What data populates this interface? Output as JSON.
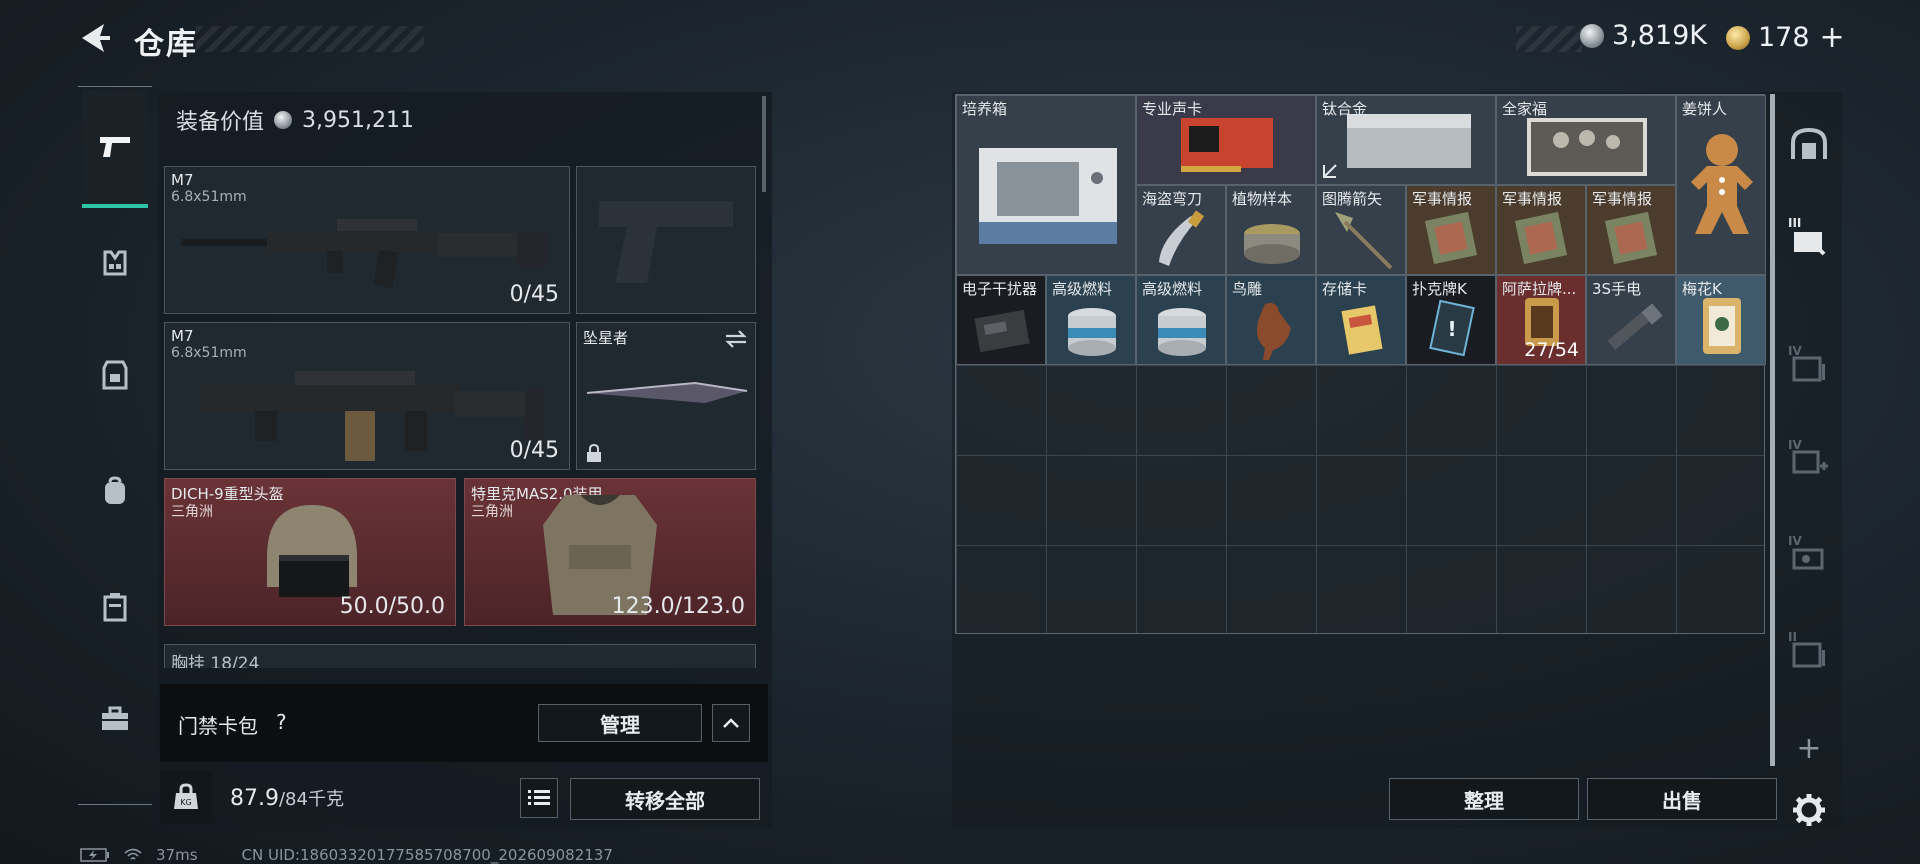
{
  "header": {
    "title": "仓库",
    "silver_amount": "3,819K",
    "gold_amount": "178"
  },
  "equipment": {
    "value_label": "装备价值",
    "value": "3,951,211",
    "primary_weapon": {
      "name": "M7",
      "caliber": "6.8x51mm",
      "ammo": "0/45"
    },
    "secondary_weapon": {
      "name": "M7",
      "caliber": "6.8x51mm",
      "ammo": "0/45"
    },
    "melee": {
      "name": "坠星者"
    },
    "helmet": {
      "name": "DICH-9重型头盔",
      "origin": "三角洲",
      "durability": "50.0/50.0"
    },
    "armor": {
      "name": "特里克MAS2.0装甲",
      "origin": "三角洲",
      "durability": "123.0/123.0"
    },
    "chest_rig_partial": "胸挂 18/24"
  },
  "keycard": {
    "label": "门禁卡包",
    "help": "?",
    "manage_label": "管理"
  },
  "weight": {
    "current": "87.9",
    "max_unit": "/84千克",
    "transfer_all_label": "转移全部"
  },
  "status": {
    "ping": "37ms",
    "uid": "CN UID:18603320177585708700_202609082137"
  },
  "stash_items": [
    {
      "name": "培养箱",
      "icon": "incubator-icon"
    },
    {
      "name": "专业声卡",
      "icon": "sound-card-icon"
    },
    {
      "name": "钛合金",
      "icon": "titanium-plate-icon"
    },
    {
      "name": "全家福",
      "icon": "family-photo-icon"
    },
    {
      "name": "姜饼人",
      "icon": "gingerbread-icon"
    },
    {
      "name": "海盗弯刀",
      "icon": "pirate-knife-icon"
    },
    {
      "name": "植物样本",
      "icon": "plant-sample-icon"
    },
    {
      "name": "图腾箭矢",
      "icon": "totem-arrow-icon"
    },
    {
      "name": "军事情报",
      "icon": "intel-icon"
    },
    {
      "name": "军事情报",
      "icon": "intel-icon"
    },
    {
      "name": "军事情报",
      "icon": "intel-icon"
    },
    {
      "name": "电子干扰器",
      "icon": "jammer-icon"
    },
    {
      "name": "高级燃料",
      "icon": "fuel-can-icon"
    },
    {
      "name": "高级燃料",
      "icon": "fuel-can-icon"
    },
    {
      "name": "鸟雕",
      "icon": "bird-statue-icon"
    },
    {
      "name": "存储卡",
      "icon": "memory-card-icon"
    },
    {
      "name": "扑克牌K",
      "icon": "poker-card-icon"
    },
    {
      "name": "阿萨拉牌...",
      "icon": "asala-card-icon",
      "count": "27/54"
    },
    {
      "name": "3S手电",
      "icon": "flashlight-icon"
    },
    {
      "name": "梅花K",
      "icon": "club-king-icon"
    }
  ],
  "actions": {
    "organize_label": "整理",
    "sell_label": "出售"
  },
  "side_nav_numerals": [
    "III",
    "IV",
    "IV",
    "IV",
    "II"
  ]
}
